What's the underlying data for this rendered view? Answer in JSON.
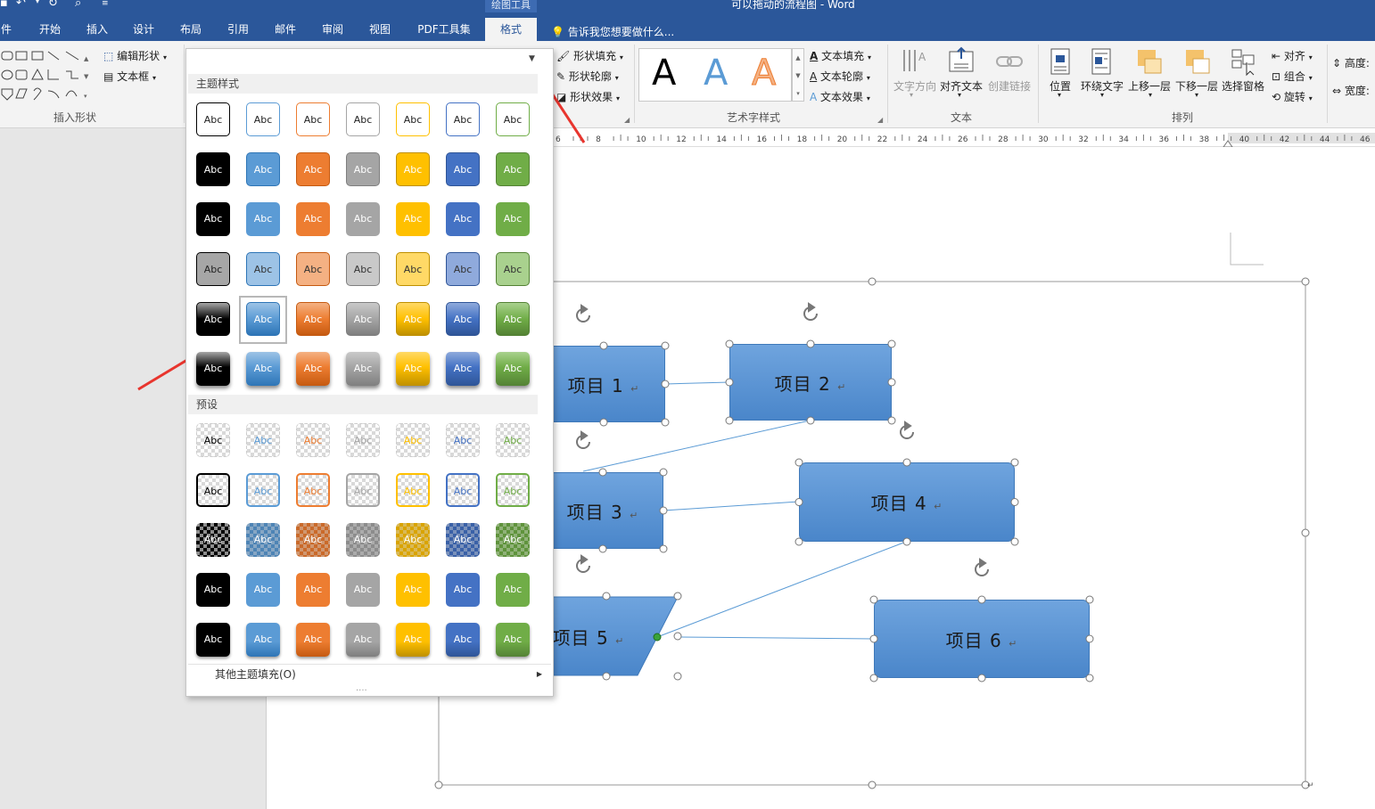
{
  "window": {
    "title": "可以拖动的流程图 - Word",
    "context_tool": "绘图工具"
  },
  "tabs": [
    "件",
    "开始",
    "插入",
    "设计",
    "布局",
    "引用",
    "邮件",
    "审阅",
    "视图",
    "PDF工具集",
    "格式"
  ],
  "active_tab": "格式",
  "tell_me": "告诉我您想要做什么...",
  "ribbon": {
    "insert_shapes": {
      "edit_shape": "编辑形状",
      "text_box": "文本框",
      "group_label": "插入形状"
    },
    "shape_styles": {
      "fill": "形状填充",
      "outline": "形状轮廓",
      "effect": "形状效果"
    },
    "wordart": {
      "sample": "A",
      "text_fill": "文本填充",
      "text_outline": "文本轮廓",
      "text_effect": "文本效果",
      "group_label": "艺术字样式"
    },
    "text": {
      "direction": "文字方向",
      "align": "对齐文本",
      "link": "创建链接",
      "group_label": "文本"
    },
    "arrange": {
      "position": "位置",
      "wrap": "环绕文字",
      "forward": "上移一层",
      "backward": "下移一层",
      "selection_pane": "选择窗格",
      "align": "对齐",
      "group": "组合",
      "rotate": "旋转",
      "group_label": "排列"
    },
    "size": {
      "height": "高度:",
      "width": "宽度:"
    }
  },
  "ruler": {
    "ticks": [
      "6",
      "8",
      "10",
      "12",
      "14",
      "16",
      "18",
      "20",
      "22",
      "24",
      "26",
      "28",
      "30",
      "32",
      "34",
      "36",
      "38",
      "40",
      "42",
      "44",
      "46"
    ]
  },
  "gallery": {
    "theme_header": "主题样式",
    "preset_header": "预设",
    "sample_text": "Abc",
    "more_fills": "其他主题填充(O)",
    "more_fills_key": "O",
    "colors": [
      "#000000",
      "#5b9bd5",
      "#ed7d31",
      "#a5a5a5",
      "#ffc000",
      "#4472c4",
      "#70ad47"
    ],
    "selected": {
      "row": 5,
      "col": 2
    }
  },
  "shapes": [
    {
      "id": "item1",
      "label": "项目 1"
    },
    {
      "id": "item2",
      "label": "项目 2"
    },
    {
      "id": "item3",
      "label": "项目 3"
    },
    {
      "id": "item4",
      "label": "项目 4"
    },
    {
      "id": "item5",
      "label": "项目 5"
    },
    {
      "id": "item6",
      "label": "项目 6"
    }
  ],
  "paragraph_mark": "↵"
}
